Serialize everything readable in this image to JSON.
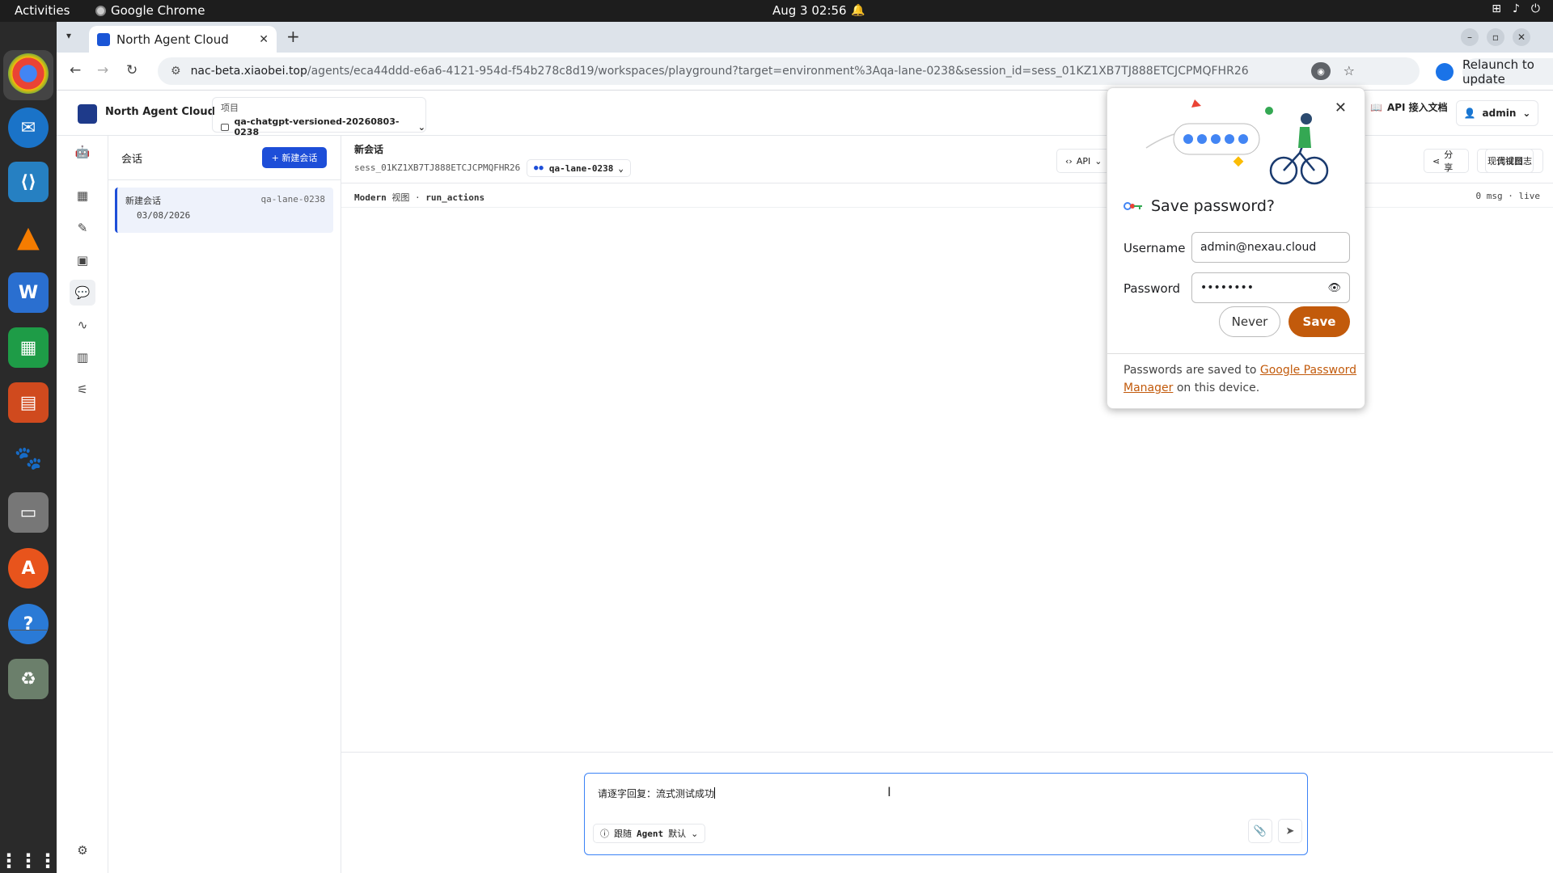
{
  "os": {
    "activities": "Activities",
    "app_name": "Google Chrome",
    "clock": "Aug 3  02:56"
  },
  "dock": {
    "items": [
      "chrome",
      "thunderbird",
      "vscode",
      "vlc",
      "writer",
      "calc",
      "impress",
      "gimp",
      "files",
      "app-center",
      "help",
      "trash",
      "show-apps"
    ]
  },
  "browser": {
    "tab_title": "North Agent Cloud",
    "url_host": "nac-beta.xiaobei.top",
    "url_path": "/agents/eca44ddd-e6a6-4121-954d-f54b278c8d19/workspaces/playground?target=environment%3Aqa-lane-0238&session_id=sess_01KZ1XB7TJ888ETCJCPMQFHR26",
    "relaunch_label": "Relaunch to update"
  },
  "app": {
    "brand": "North Agent Cloud",
    "project_label": "项目",
    "project_value": "qa-chatgpt-versioned-20260803-0238",
    "api_docs": "API 接入文档",
    "user": "admin",
    "sessions_title": "会话",
    "new_session_btn": "+ 新建会话",
    "session_item": {
      "name": "新建会话",
      "lane": "qa-lane-0238",
      "date": "03/08/2026"
    },
    "chat_title": "新会话",
    "session_id": "sess_01KZ1XB7TJ888ETCJCPMQFHR26",
    "lane_pill": "qa-lane-0238",
    "view_mode": "Modern",
    "view_word": "视图",
    "view_action": "run_actions",
    "msg_status": "0 msg · live",
    "api_btn": "API",
    "share_btn": "分享",
    "modern_view_btn": "现代视图",
    "debug_log_btn": "调试日志",
    "composer_text": "请逐字回复：流式测试成功",
    "agent_pill_prefix": "跟随",
    "agent_pill_name": "Agent",
    "agent_pill_suffix": "默认"
  },
  "password_prompt": {
    "title": "Save password?",
    "username_label": "Username",
    "username_value": "admin@nexau.cloud",
    "password_label": "Password",
    "password_value": "••••••••",
    "never_btn": "Never",
    "save_btn": "Save",
    "footer_text": "Passwords are saved to ",
    "footer_link": "Google Password Manager",
    "footer_tail": " on this device."
  },
  "colors": {
    "accent": "#1d4ed8",
    "save_orange": "#c25a0b"
  }
}
